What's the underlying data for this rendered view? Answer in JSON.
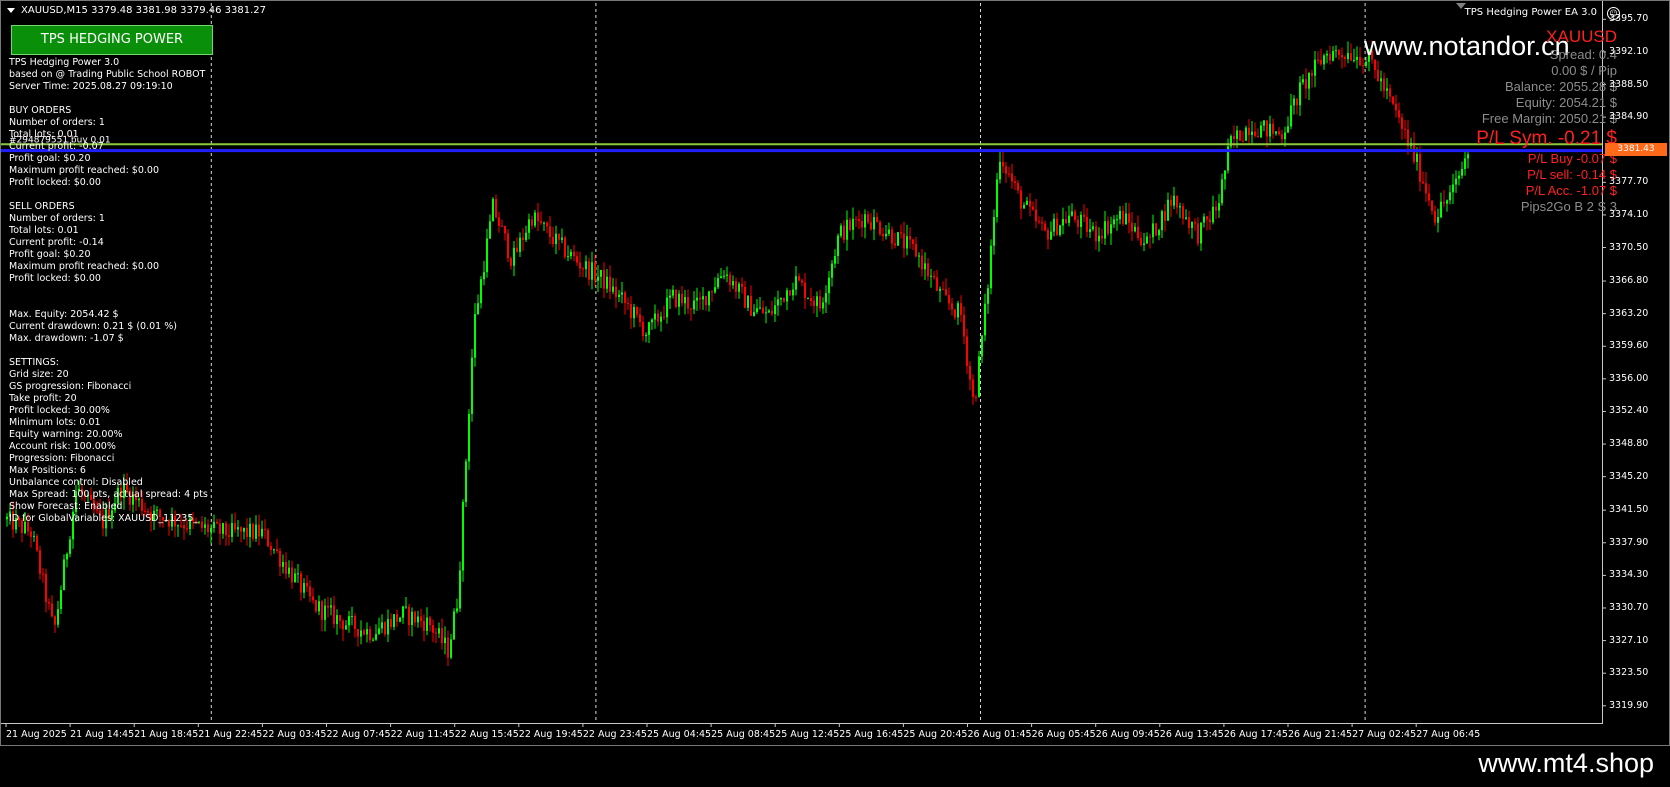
{
  "header": {
    "symbol_line": "XAUUSD,M15  3379.48 3381.98 3379.46 3381.27"
  },
  "ea_button": {
    "label": "TPS HEDGING POWER"
  },
  "info_panel": {
    "lines": [
      "TPS Hedging Power 3.0",
      "based on @ Trading Public School ROBOT",
      "Server Time: 2025.08.27 09:19:10",
      "",
      "BUY ORDERS",
      "Number of orders: 1",
      "Total lots: 0.01",
      "Current profit: -0.07",
      "Profit goal: $0.20",
      "Maximum profit reached: $0.00",
      "Profit locked: $0.00",
      "",
      "SELL ORDERS",
      "Number of orders: 1",
      "Total lots: 0.01",
      "Current profit: -0.14",
      "Profit goal: $0.20",
      "Maximum profit reached: $0.00",
      "Profit locked: $0.00",
      "",
      "",
      "Max. Equity: 2054.42 $",
      "Current drawdown: 0.21 $ (0.01 %)",
      "Max. drawdown: -1.07 $",
      "",
      "SETTINGS:",
      "Grid size: 20",
      "GS progression: Fibonacci",
      "Take profit: 20",
      "Profit locked: 30.00%",
      "Minimum lots: 0.01",
      "Equity warning: 20.00%",
      "Account risk: 100.00%",
      "Progression: Fibonacci",
      "Max Positions: 6",
      "Unbalance control: Disabled",
      "Max Spread: 100 pts, actual spread: 4 pts",
      "Show Forecast: Enabled",
      "ID for GlobalVariables: XAUUSD_11235_"
    ],
    "overlay_ticket": "#294879551 buy 0.01"
  },
  "ea_title": "TPS Hedging Power EA 3.0",
  "stats_panel": {
    "symbol": "XAUUSD",
    "spread": "Spread: 0.4",
    "pip_value": "0.00 $ / Pip",
    "balance": "Balance: 2055.28 $",
    "equity": "Equity: 2054.21 $",
    "free_margin": "Free Margin: 2050.21 $",
    "pl_sym": "P/L Sym. -0.21 $",
    "pl_buy": "P/L Buy -0.07 $",
    "pl_sell": "P/L sell: -0.14 $",
    "pl_acc": "P/L Acc. -1.07 $",
    "pips2go": "Pips2Go B 2 S 3"
  },
  "watermarks": {
    "top": "www.notandor.cn",
    "bottom": "www.mt4.shop"
  },
  "current_price_tag": "3381.43",
  "colors": {
    "bull": "#00ff00",
    "bear": "#ff0000",
    "bid_line": "#2020ff",
    "buy_line": "#8cc83c",
    "price_tag": "#ff6a1a",
    "button": "#0a8f0a"
  },
  "chart_data": {
    "type": "candlestick",
    "symbol": "XAUUSD",
    "timeframe": "M15",
    "ylim": [
      3318.0,
      3397.5
    ],
    "y_ticks": [
      "3395.70",
      "3392.10",
      "3388.50",
      "3384.90",
      "3381.43",
      "3377.70",
      "3374.10",
      "3370.50",
      "3366.80",
      "3363.20",
      "3359.60",
      "3356.00",
      "3352.40",
      "3348.80",
      "3345.20",
      "3341.50",
      "3337.90",
      "3334.30",
      "3330.70",
      "3327.10",
      "3323.50",
      "3319.90"
    ],
    "x_ticks": [
      "21 Aug 2025",
      "21 Aug 14:45",
      "21 Aug 18:45",
      "21 Aug 22:45",
      "22 Aug 03:45",
      "22 Aug 07:45",
      "22 Aug 11:45",
      "22 Aug 15:45",
      "22 Aug 19:45",
      "22 Aug 23:45",
      "25 Aug 04:45",
      "25 Aug 08:45",
      "25 Aug 12:45",
      "25 Aug 16:45",
      "25 Aug 20:45",
      "26 Aug 01:45",
      "26 Aug 05:45",
      "26 Aug 09:45",
      "26 Aug 13:45",
      "26 Aug 17:45",
      "26 Aug 21:45",
      "27 Aug 02:45",
      "27 Aug 06:45"
    ],
    "period_separators": [
      3,
      9,
      15,
      21
    ],
    "horizontal_lines": [
      {
        "name": "buy-entry-line",
        "price": 3381.9
      },
      {
        "name": "bid-line",
        "price": 3381.2
      }
    ],
    "close_path": [
      [
        0,
        3340.5
      ],
      [
        0.4,
        3339
      ],
      [
        0.75,
        3328
      ],
      [
        1.1,
        3344
      ],
      [
        1.5,
        3340
      ],
      [
        1.8,
        3344
      ],
      [
        2.3,
        3341
      ],
      [
        2.8,
        3340
      ],
      [
        3.4,
        3339
      ],
      [
        4.0,
        3339
      ],
      [
        4.4,
        3335
      ],
      [
        4.8,
        3331
      ],
      [
        5.3,
        3329
      ],
      [
        5.7,
        3328
      ],
      [
        6.2,
        3330
      ],
      [
        6.6,
        3329
      ],
      [
        6.9,
        3326
      ],
      [
        7.05,
        3332
      ],
      [
        7.3,
        3362
      ],
      [
        7.6,
        3375
      ],
      [
        7.9,
        3369
      ],
      [
        8.2,
        3374
      ],
      [
        8.6,
        3371
      ],
      [
        8.9,
        3369
      ],
      [
        9.3,
        3367
      ],
      [
        9.7,
        3364
      ],
      [
        10.0,
        3361
      ],
      [
        10.4,
        3365
      ],
      [
        10.8,
        3364
      ],
      [
        11.2,
        3368
      ],
      [
        11.6,
        3364
      ],
      [
        11.9,
        3363
      ],
      [
        12.3,
        3367
      ],
      [
        12.7,
        3364
      ],
      [
        13.0,
        3372
      ],
      [
        13.4,
        3374
      ],
      [
        13.8,
        3372
      ],
      [
        14.2,
        3370
      ],
      [
        14.6,
        3365
      ],
      [
        14.9,
        3363
      ],
      [
        15.1,
        3353
      ],
      [
        15.3,
        3365
      ],
      [
        15.5,
        3381
      ],
      [
        15.8,
        3376
      ],
      [
        16.2,
        3372
      ],
      [
        16.6,
        3374
      ],
      [
        17.0,
        3372
      ],
      [
        17.4,
        3374
      ],
      [
        17.8,
        3371
      ],
      [
        18.2,
        3376
      ],
      [
        18.6,
        3372
      ],
      [
        18.9,
        3375
      ],
      [
        19.1,
        3382
      ],
      [
        19.4,
        3384
      ],
      [
        19.9,
        3383
      ],
      [
        20.2,
        3388
      ],
      [
        20.6,
        3392
      ],
      [
        21.0,
        3392
      ],
      [
        21.3,
        3391
      ],
      [
        21.7,
        3385
      ],
      [
        22.0,
        3380
      ],
      [
        22.3,
        3374
      ],
      [
        22.6,
        3377
      ],
      [
        22.8,
        3381
      ]
    ]
  }
}
